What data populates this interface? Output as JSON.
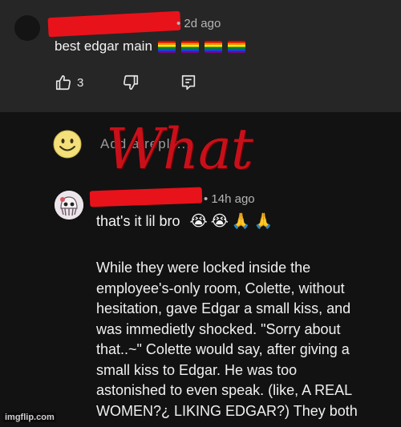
{
  "comment": {
    "time": "• 2d ago",
    "text": "best edgar main",
    "flags": 4,
    "likes": "3"
  },
  "reply_bar": {
    "placeholder": "Add a reply..."
  },
  "overlay": {
    "caption": "What"
  },
  "reply": {
    "time": "• 14h ago",
    "first_line": "that's it lil bro",
    "first_line_emojis": [
      "😭",
      "😭",
      "🙏",
      "🙏"
    ],
    "story_lines": [
      "While they were locked inside the",
      "employee's-only room, Colette, without",
      "hesitation, gave Edgar a small kiss, and",
      "was immedietly shocked. \"Sorry about",
      "that..~\" Colette would say, after giving a",
      "small kiss to Edgar. He was too",
      "astonished to even speak. (like, A REAL",
      "WOMEN?¿ LIKING EDGAR?) They both"
    ]
  },
  "watermark": "imgflip.com",
  "colors": {
    "redaction": "#e8121b",
    "caption": "#c8101a",
    "background": "#121212",
    "panel": "#262626"
  }
}
